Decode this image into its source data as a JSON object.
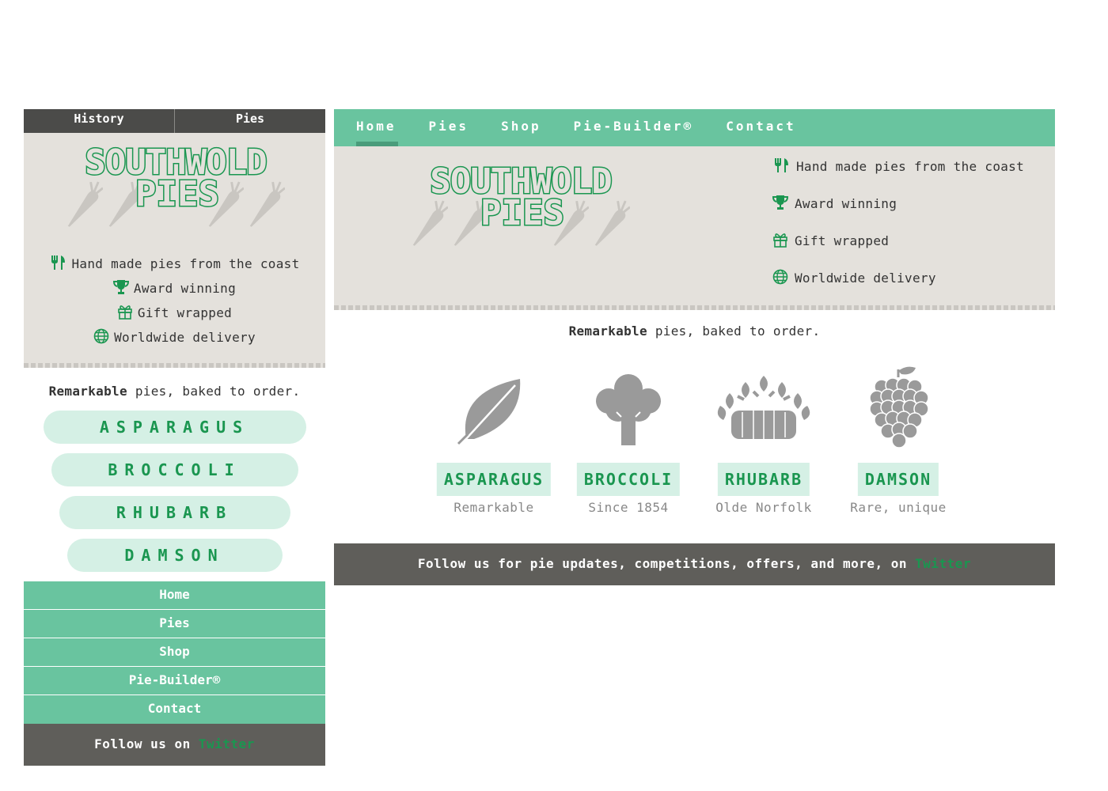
{
  "brand": {
    "line1": "SOUTHWOLD",
    "line2": "PIES",
    "green": "#1a9650",
    "accent": "#69c49f",
    "dark": "#4b4b49",
    "cream": "#e4e1dc"
  },
  "features": [
    {
      "icon": "cutlery-icon",
      "text": "Hand made pies from the coast"
    },
    {
      "icon": "trophy-icon",
      "text": "Award winning"
    },
    {
      "icon": "gift-icon",
      "text": "Gift wrapped"
    },
    {
      "icon": "globe-icon",
      "text": "Worldwide delivery"
    }
  ],
  "tagline": {
    "bold": "Remarkable",
    "rest": " pies, baked to order."
  },
  "mobile": {
    "top_nav": [
      "History",
      "Pies"
    ],
    "pies": [
      "ASPARAGUS",
      "BROCCOLI",
      "RHUBARB",
      "DAMSON"
    ],
    "nav": [
      "Home",
      "Pies",
      "Shop",
      "Pie-Builder®",
      "Contact"
    ],
    "follow": {
      "text": "Follow us on ",
      "link": "Twitter"
    }
  },
  "desktop": {
    "nav": [
      "Home",
      "Pies",
      "Shop",
      "Pie-Builder®",
      "Contact"
    ],
    "active_nav": "Home",
    "pies": [
      {
        "name": "ASPARAGUS",
        "sub": "Remarkable",
        "icon": "leaf-icon"
      },
      {
        "name": "BROCCOLI",
        "sub": "Since 1854",
        "icon": "broccoli-icon"
      },
      {
        "name": "RHUBARB",
        "sub": "Olde Norfolk",
        "icon": "rhubarb-icon"
      },
      {
        "name": "DAMSON",
        "sub": "Rare, unique",
        "icon": "grapes-icon"
      }
    ],
    "follow": {
      "text": "Follow us for pie updates, competitions, offers, and more, on ",
      "link": "Twitter"
    }
  }
}
